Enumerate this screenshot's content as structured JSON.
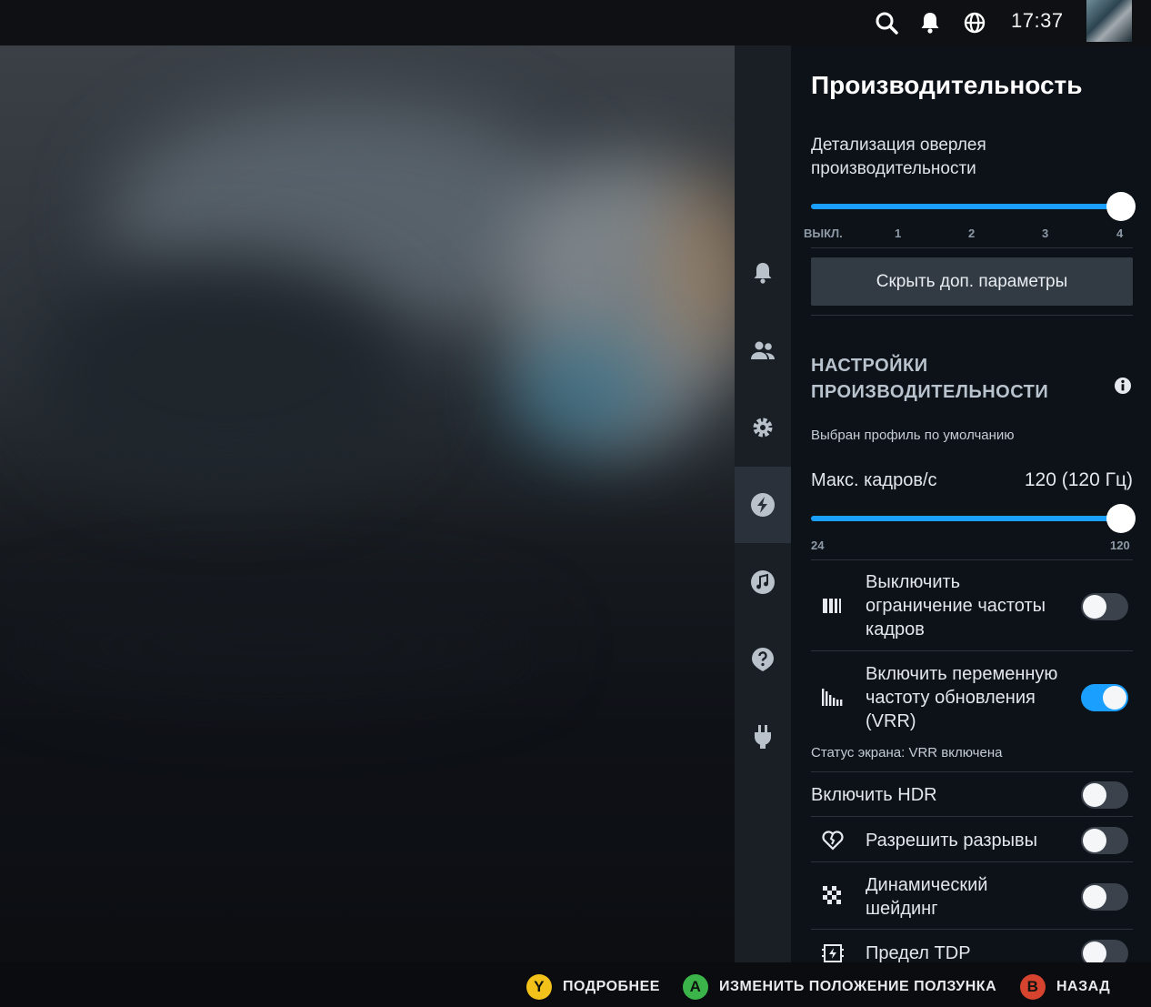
{
  "topbar": {
    "time": "17:37",
    "icons": [
      "search-icon",
      "bell-icon",
      "globe-icon"
    ]
  },
  "rail": {
    "items": [
      "notifications",
      "friends",
      "settings",
      "performance",
      "music",
      "help",
      "power"
    ],
    "active": "performance"
  },
  "panel": {
    "title": "Производительность",
    "overlay_level": {
      "label_line1": "Детализация оверлея",
      "label_line2": "производительности",
      "ticks": [
        "ВЫКЛ.",
        "1",
        "2",
        "3",
        "4"
      ],
      "value": 4
    },
    "toggle_advanced_button": "Скрыть доп. параметры",
    "section": {
      "title_line1": "НАСТРОЙКИ",
      "title_line2": "ПРОИЗВОДИТЕЛЬНОСТИ",
      "profile_note": "Выбран профиль по умолчанию"
    },
    "fps": {
      "label": "Макс. кадров/с",
      "value_text": "120 (120 Гц)",
      "min": "24",
      "max": "120",
      "value": 120
    },
    "rows": [
      {
        "key": "framerate_limit",
        "line1": "Выключить",
        "line2": "ограничение частоты",
        "line3": "кадров",
        "on": false
      },
      {
        "key": "vrr",
        "line1": "Включить переменную",
        "line2": "частоту обновления",
        "line3": "(VRR)",
        "on": true
      },
      {
        "key": "hdr",
        "line1": "Включить HDR",
        "on": false
      },
      {
        "key": "tearing",
        "line1": "Разрешить разрывы",
        "on": false
      },
      {
        "key": "dynamic_shading",
        "line1": "Динамический",
        "line2": "шейдинг",
        "on": false
      },
      {
        "key": "tdp",
        "line1": "Предел TDP",
        "on": false
      }
    ],
    "display_status": "Статус экрана: VRR включена"
  },
  "bottombar": {
    "hints": [
      {
        "button": "Y",
        "label": "ПОДРОБНЕЕ",
        "color": "#f2c21b"
      },
      {
        "button": "A",
        "label": "ИЗМЕНИТЬ ПОЛОЖЕНИЕ ПОЛЗУНКА",
        "color": "#3bb54a"
      },
      {
        "button": "B",
        "label": "НАЗАД",
        "color": "#d6432f"
      }
    ]
  },
  "colors": {
    "accent": "#1a9fff",
    "panel_bg": "#0d1218",
    "rail_bg": "#1a1f26"
  }
}
